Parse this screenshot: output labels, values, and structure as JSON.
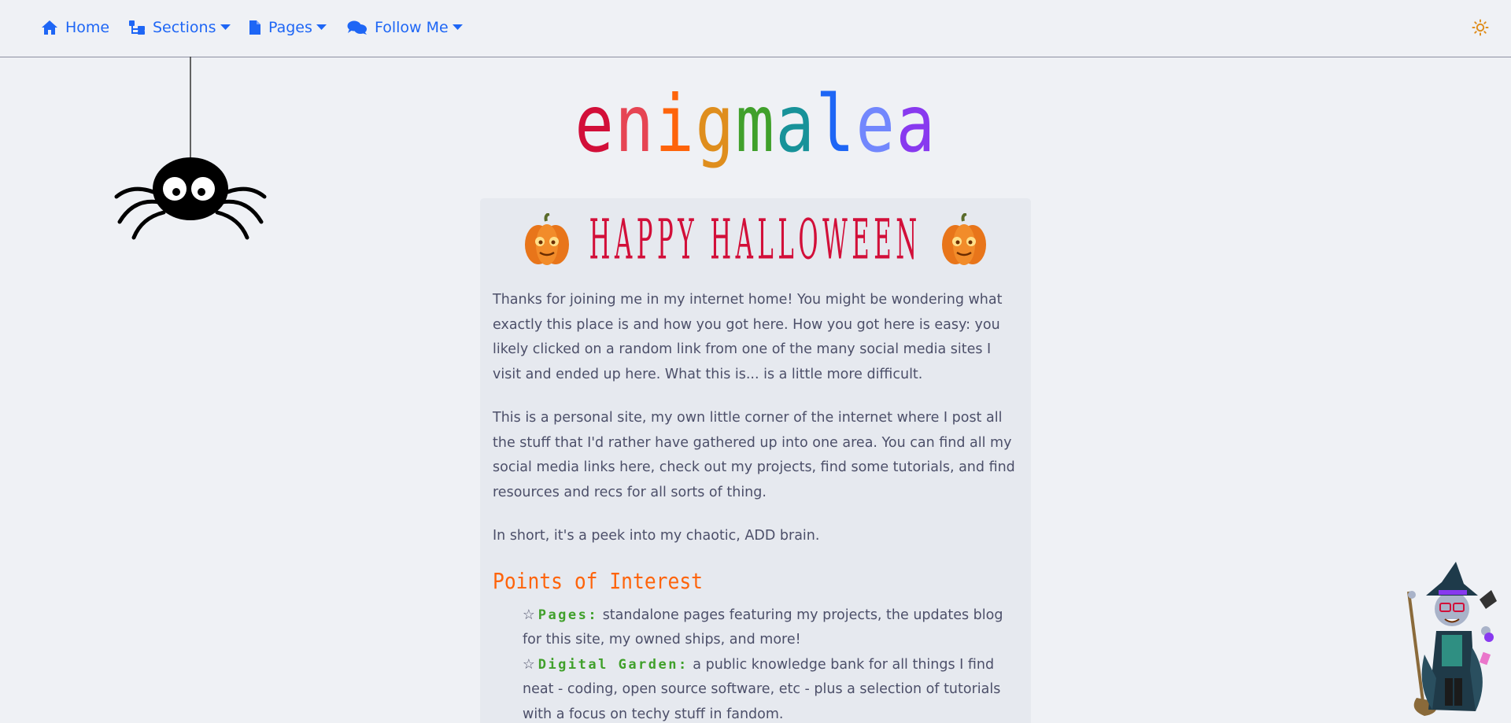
{
  "nav": {
    "home": "Home",
    "sections": "Sections",
    "pages": "Pages",
    "follow": "Follow Me",
    "icons": {
      "home": "home-icon",
      "sections": "sitemap-icon",
      "pages": "file-icon",
      "follow": "comments-icon",
      "theme": "sun-icon"
    }
  },
  "logo": {
    "letters": [
      "e",
      "n",
      "i",
      "g",
      "m",
      "a",
      "l",
      "e",
      "a"
    ],
    "colors": [
      "#d20f39",
      "#e64553",
      "#fe640b",
      "#df8e1d",
      "#40a02b",
      "#179299",
      "#1e66f5",
      "#7287fd",
      "#8839ef"
    ]
  },
  "banner": {
    "text": "HAPPY HALLOWEEN"
  },
  "content": {
    "paragraphs": [
      "Thanks for joining me in my internet home! You might be wondering what exactly this place is and how you got here. How you got here is easy: you likely clicked on a random link from one of the many social media sites I visit and ended up here. What this is... is a little more difficult.",
      "This is a personal site, my own little corner of the internet where I post all the stuff that I'd rather have gathered up into one area. You can find all my social media links here, check out my projects, find some tutorials, and find resources and recs for all sorts of thing.",
      "In short, it's a peek into my chaotic, ADD brain."
    ],
    "heading": "Points of Interest",
    "items": [
      {
        "star": "☆",
        "term": "Pages:",
        "desc": " standalone pages featuring my projects, the updates blog for this site, my owned ships, and more!"
      },
      {
        "star": "☆",
        "term": "Digital Garden:",
        "desc": " a public knowledge bank for all things I find neat - coding, open source software, etc - plus a selection of tutorials with a focus on techy stuff in fandom."
      }
    ]
  },
  "colors": {
    "accent": "#1e66f5",
    "background": "#eff1f5",
    "card": "#e6e9ef",
    "text": "#4c4f69",
    "heading": "#fe640b",
    "term": "#40a02b",
    "banner": "#d20f39"
  }
}
